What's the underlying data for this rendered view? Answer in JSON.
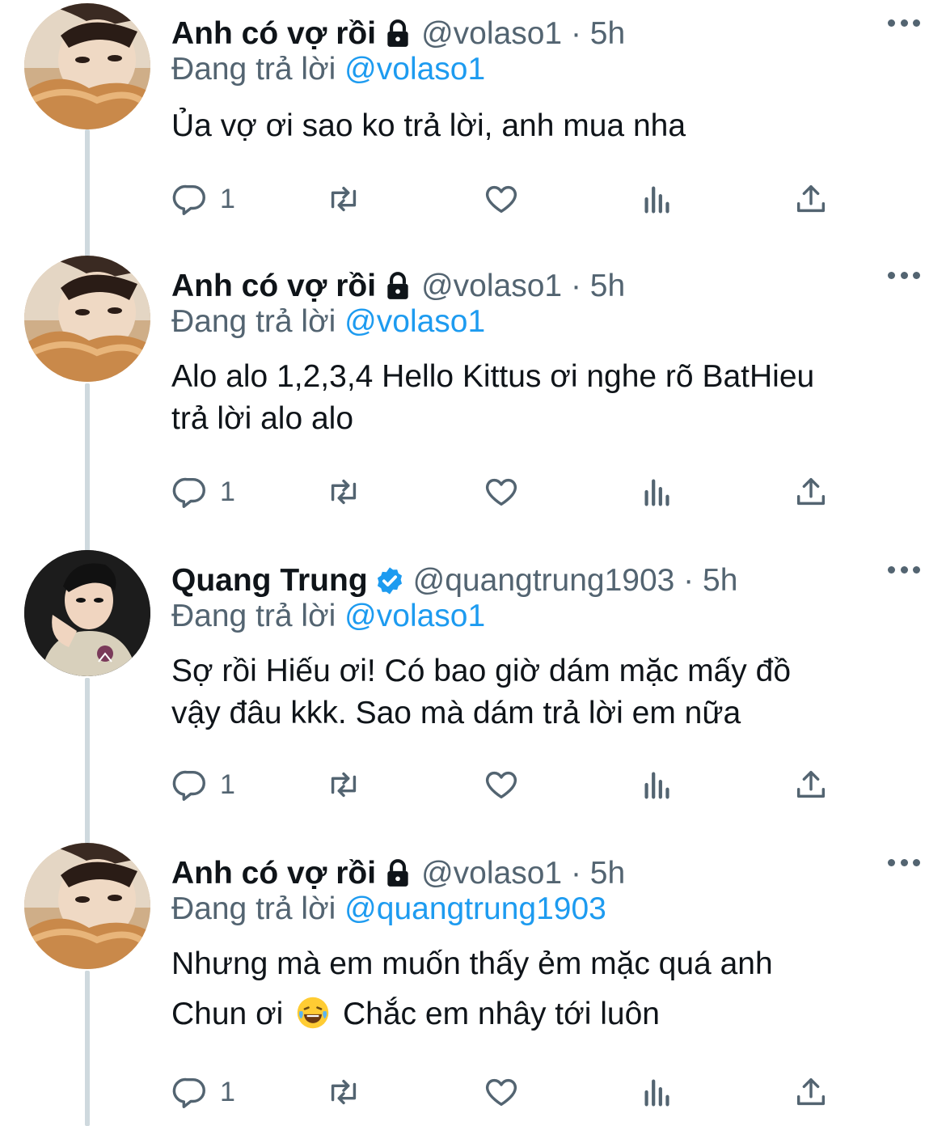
{
  "thread": {
    "tweets": [
      {
        "display_name": "Anh có vợ rồi",
        "badge_icon": "lock-icon",
        "handle_time": "@volaso1 · 5h",
        "reply_prefix": "Đang trả lời",
        "reply_mention": "@volaso1",
        "text": "Ủa vợ ơi sao ko trả lời, anh mua nha",
        "reply_count": "1"
      },
      {
        "display_name": "Anh có vợ rồi",
        "badge_icon": "lock-icon",
        "handle_time": "@volaso1 · 5h",
        "reply_prefix": "Đang trả lời",
        "reply_mention": "@volaso1",
        "text_line1": "Alo alo 1,2,3,4 Hello Kittus ơi nghe rõ BatHieu",
        "text_line2": "trả lời alo alo",
        "reply_count": "1"
      },
      {
        "display_name": "Quang Trung",
        "badge_icon": "verified-badge-icon",
        "handle_time": "@quangtrung1903 · 5h",
        "reply_prefix": "Đang trả lời",
        "reply_mention": "@volaso1",
        "text_line1": "Sợ rồi Hiếu ơi! Có bao giờ dám mặc mấy đồ",
        "text_line2": "vậy đâu kkk. Sao mà dám trả lời em nữa",
        "reply_count": "1"
      },
      {
        "display_name": "Anh có vợ rồi",
        "badge_icon": "lock-icon",
        "handle_time": "@volaso1 · 5h",
        "reply_prefix": "Đang trả lời",
        "reply_mention": "@quangtrung1903",
        "text_line1": "Nhưng mà em muốn thấy ẻm mặc quá anh",
        "text_line2_a": "Chun ơi",
        "text_line2_b": "Chắc em nhây tới luôn",
        "emoji": "laughing-tears-emoji",
        "reply_count": "1"
      }
    ]
  },
  "colors": {
    "text": "#0f1419",
    "secondary": "#536471",
    "mention": "#1d9bf0",
    "thread_line": "#cfd9de",
    "verified": "#1d9bf0"
  },
  "icons": [
    "reply-icon",
    "retweet-icon",
    "like-icon",
    "analytics-icon",
    "share-icon",
    "more-icon"
  ]
}
